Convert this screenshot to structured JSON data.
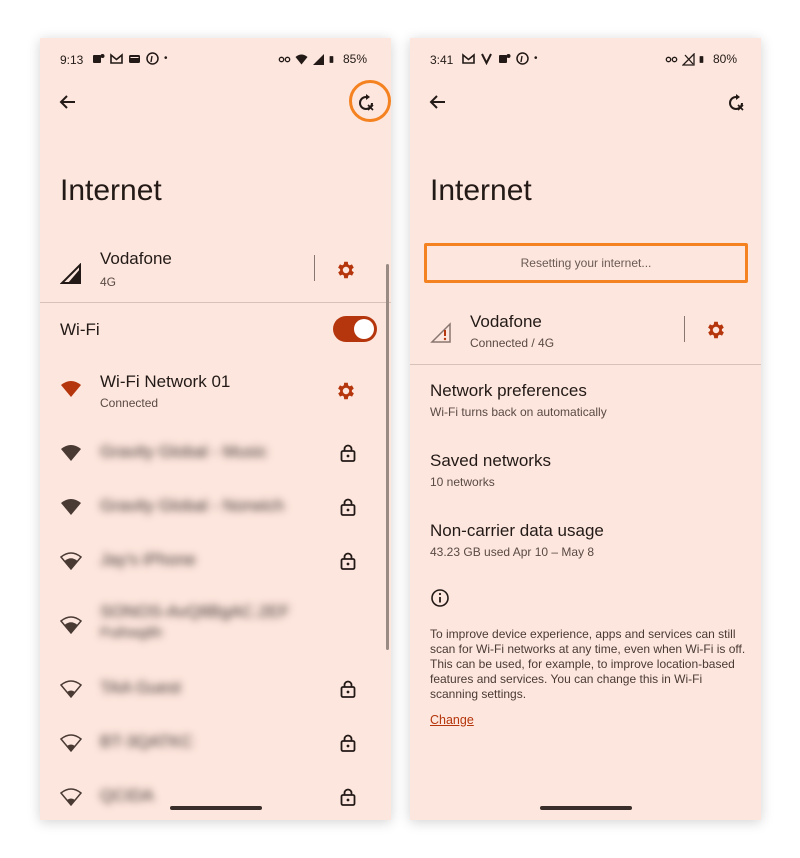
{
  "colors": {
    "background": "#fde6dd",
    "accent": "#b5360c",
    "highlight": "#f58220",
    "text": "#231a17"
  },
  "left": {
    "status": {
      "time": "9:13",
      "battery": "85%",
      "dot": "•"
    },
    "title": "Internet",
    "carrier": {
      "name": "Vodafone",
      "sub": "4G",
      "icon": "cell-signal-icon"
    },
    "wifi": {
      "label": "Wi-Fi",
      "enabled": true
    },
    "networks": [
      {
        "name": "Wi-Fi Network 01",
        "sub": "Connected",
        "icon": "wifi-full-icon",
        "action": "gear-icon"
      },
      {
        "name": "Gravity Global - Music",
        "sub": "",
        "icon": "wifi-full-icon",
        "action": "lock-icon"
      },
      {
        "name": "Gravity Global - Norwich",
        "sub": "",
        "icon": "wifi-full-icon",
        "action": "lock-icon"
      },
      {
        "name": "Jay's iPhone",
        "sub": "",
        "icon": "wifi-medium-icon",
        "action": "lock-icon"
      },
      {
        "name": "SONOS-AvQ8BgAC.2EF",
        "sub": "Puthwg8h",
        "icon": "wifi-medium-icon",
        "action": ""
      },
      {
        "name": "TAA Guest",
        "sub": "",
        "icon": "wifi-weak-icon",
        "action": "lock-icon"
      },
      {
        "name": "BT-3QATKC",
        "sub": "",
        "icon": "wifi-weak-icon",
        "action": "lock-icon"
      },
      {
        "name": "QCIDA",
        "sub": "",
        "icon": "wifi-weak-icon",
        "action": "lock-icon"
      }
    ]
  },
  "right": {
    "status": {
      "time": "3:41",
      "battery": "80%",
      "dot": "•"
    },
    "title": "Internet",
    "resetting": "Resetting your internet...",
    "carrier": {
      "name": "Vodafone",
      "sub": "Connected / 4G",
      "icon": "cell-signal-warning-icon"
    },
    "prefs": [
      {
        "title": "Network preferences",
        "sub": "Wi-Fi turns back on automatically"
      },
      {
        "title": "Saved networks",
        "sub": "10 networks"
      },
      {
        "title": "Non-carrier data usage",
        "sub": "43.23 GB used Apr 10 – May 8"
      }
    ],
    "info_text": "To improve device experience, apps and services can still scan for Wi-Fi networks at any time, even when Wi-Fi is off. This can be used, for example, to improve location-based features and services. You can change this in Wi-Fi scanning settings.",
    "change_link": "Change"
  }
}
